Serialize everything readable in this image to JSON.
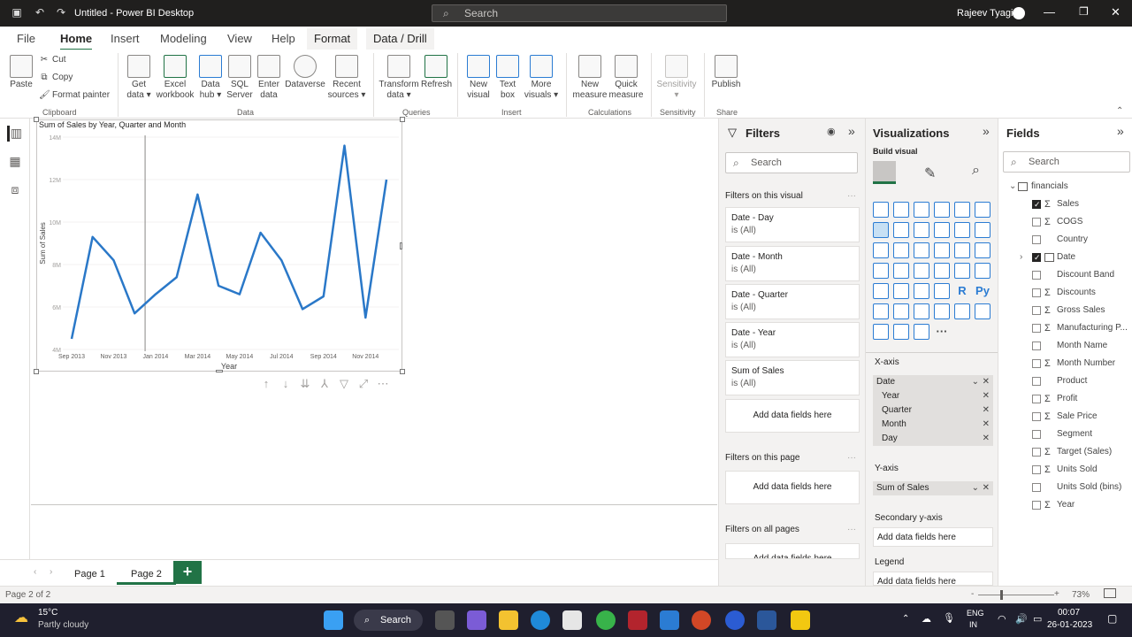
{
  "titlebar": {
    "title": "Untitled - Power BI Desktop",
    "search_placeholder": "Search",
    "user": "Rajeev Tyagi",
    "minimize": "—",
    "restore": "❐",
    "close": "✕"
  },
  "tabs": [
    "File",
    "Home",
    "Insert",
    "Modeling",
    "View",
    "Help",
    "Format",
    "Data / Drill"
  ],
  "active_tab": "Home",
  "ribbon": {
    "clipboard": {
      "paste": "Paste",
      "cut": "Cut",
      "copy": "Copy",
      "format_painter": "Format painter",
      "group": "Clipboard"
    },
    "data": {
      "get_data": [
        "Get",
        "data ▾"
      ],
      "excel": [
        "Excel",
        "workbook"
      ],
      "data_hub": [
        "Data",
        "hub ▾"
      ],
      "sql": [
        "SQL",
        "Server"
      ],
      "enter_data": [
        "Enter",
        "data"
      ],
      "dataverse": [
        "Dataverse",
        ""
      ],
      "recent": [
        "Recent",
        "sources ▾"
      ],
      "group": "Data"
    },
    "queries": {
      "transform": [
        "Transform",
        "data ▾"
      ],
      "refresh": [
        "Refresh",
        ""
      ],
      "group": "Queries"
    },
    "insert": {
      "new_visual": [
        "New",
        "visual"
      ],
      "text_box": [
        "Text",
        "box"
      ],
      "more_visuals": [
        "More",
        "visuals ▾"
      ],
      "group": "Insert"
    },
    "calculations": {
      "new_measure": [
        "New",
        "measure"
      ],
      "quick_measure": [
        "Quick",
        "measure"
      ],
      "group": "Calculations"
    },
    "sensitivity": {
      "label": [
        "Sensitivity",
        "▾"
      ],
      "group": "Sensitivity"
    },
    "share": {
      "publish": [
        "Publish",
        ""
      ],
      "group": "Share"
    }
  },
  "chart_data": {
    "type": "line",
    "title": "Sum of Sales by Year, Quarter and Month",
    "xlabel": "Year",
    "ylabel": "Sum of Sales",
    "x_ticks": [
      "Sep 2013",
      "Nov 2013",
      "Jan 2014",
      "Mar 2014",
      "May 2014",
      "Jul 2014",
      "Sep 2014",
      "Nov 2014"
    ],
    "y_ticks": [
      "4M",
      "6M",
      "8M",
      "10M",
      "12M",
      "14M"
    ],
    "ylim": [
      4,
      14
    ],
    "y_unit": "M",
    "x_months": [
      "Sep 2013",
      "Oct 2013",
      "Nov 2013",
      "Dec 2013",
      "Jan 2014",
      "Feb 2014",
      "Mar 2014",
      "Apr 2014",
      "May 2014",
      "Jun 2014",
      "Jul 2014",
      "Aug 2014",
      "Sep 2014",
      "Oct 2014",
      "Nov 2014",
      "Dec 2014"
    ],
    "series": [
      {
        "values": [
          4.5,
          9.3,
          8.2,
          5.7,
          6.6,
          7.4,
          11.3,
          7.0,
          6.6,
          9.5,
          8.2,
          5.9,
          6.5,
          13.6,
          5.5,
          12.0
        ]
      }
    ],
    "color": "#2a78c8",
    "grid": true,
    "marker": "Jan 2014"
  },
  "visual_toolbar": [
    "↑",
    "↓",
    "⇊",
    "⅄",
    "▽",
    "⤢",
    "⋯"
  ],
  "pages": [
    "Page 1",
    "Page 2"
  ],
  "active_page": "Page 2",
  "add_page": "+",
  "status": {
    "page": "Page 2 of 2",
    "zoom": "73%",
    "zoom_minus": "-",
    "zoom_plus": "+"
  },
  "filters": {
    "title": "Filters",
    "search": "Search",
    "on_visual": "Filters on this visual",
    "cards": [
      {
        "name": "Date - Day",
        "value": "is (All)"
      },
      {
        "name": "Date - Month",
        "value": "is (All)"
      },
      {
        "name": "Date - Quarter",
        "value": "is (All)"
      },
      {
        "name": "Date - Year",
        "value": "is (All)"
      },
      {
        "name": "Sum of Sales",
        "value": "is (All)"
      }
    ],
    "add_here": "Add data fields here",
    "on_page": "Filters on this page",
    "on_all_pages": "Filters on all pages",
    "more": "···"
  },
  "visualizations": {
    "title": "Visualizations",
    "build": "Build visual",
    "r_label": "R",
    "py_label": "Py",
    "more": "···",
    "xaxis": "X-axis",
    "xaxis_field": "Date",
    "xaxis_children": [
      "Year",
      "Quarter",
      "Month",
      "Day"
    ],
    "yaxis": "Y-axis",
    "yaxis_field": "Sum of Sales",
    "secondary": "Secondary y-axis",
    "add_here": "Add data fields here",
    "legend": "Legend",
    "legend_add": "Add data fields here"
  },
  "fields": {
    "title": "Fields",
    "search": "Search",
    "table": "financials",
    "items": [
      {
        "name": "Sales",
        "sigma": true,
        "checked": true
      },
      {
        "name": "COGS",
        "sigma": true,
        "checked": false
      },
      {
        "name": "Country",
        "sigma": false,
        "checked": false
      },
      {
        "name": "Date",
        "sigma": false,
        "checked": true,
        "date": true
      },
      {
        "name": "Discount Band",
        "sigma": false,
        "checked": false
      },
      {
        "name": "Discounts",
        "sigma": true,
        "checked": false
      },
      {
        "name": "Gross Sales",
        "sigma": true,
        "checked": false
      },
      {
        "name": "Manufacturing P...",
        "sigma": true,
        "checked": false
      },
      {
        "name": "Month Name",
        "sigma": false,
        "checked": false
      },
      {
        "name": "Month Number",
        "sigma": true,
        "checked": false
      },
      {
        "name": "Product",
        "sigma": false,
        "checked": false
      },
      {
        "name": "Profit",
        "sigma": true,
        "checked": false
      },
      {
        "name": "Sale Price",
        "sigma": true,
        "checked": false
      },
      {
        "name": "Segment",
        "sigma": false,
        "checked": false
      },
      {
        "name": "Target (Sales)",
        "sigma": true,
        "checked": false
      },
      {
        "name": "Units Sold",
        "sigma": true,
        "checked": false
      },
      {
        "name": "Units Sold (bins)",
        "sigma": false,
        "checked": false
      },
      {
        "name": "Year",
        "sigma": true,
        "checked": false
      }
    ]
  },
  "taskbar": {
    "weather_temp": "15°C",
    "weather_desc": "Partly cloudy",
    "search": "Search",
    "lang1": "ENG",
    "lang2": "IN",
    "time": "00:07",
    "date": "26-01-2023"
  }
}
